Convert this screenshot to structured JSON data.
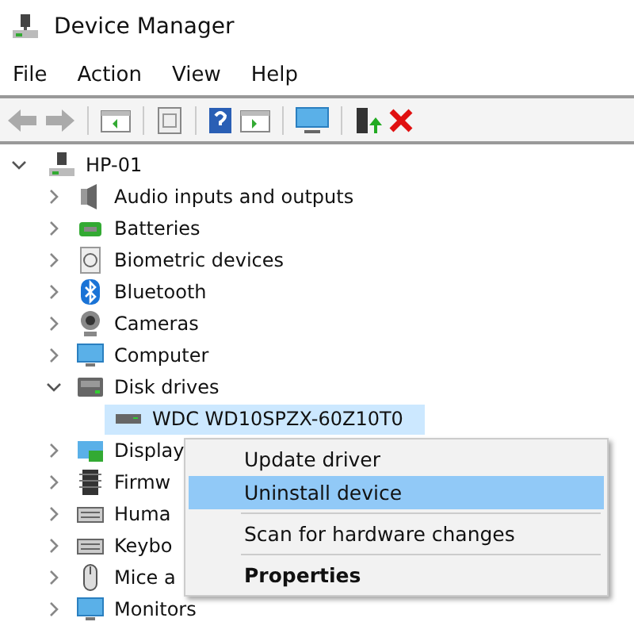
{
  "window": {
    "title": "Device Manager"
  },
  "menu_bar": [
    "File",
    "Action",
    "View",
    "Help"
  ],
  "tree": {
    "label": "HP-01",
    "expanded": true,
    "children": [
      {
        "label": "Audio inputs and outputs",
        "expanded": false
      },
      {
        "label": "Batteries",
        "expanded": false
      },
      {
        "label": "Biometric devices",
        "expanded": false
      },
      {
        "label": "Bluetooth",
        "expanded": false
      },
      {
        "label": "Cameras",
        "expanded": false
      },
      {
        "label": "Computer",
        "expanded": false
      },
      {
        "label": "Disk drives",
        "expanded": true,
        "children": [
          {
            "label": "WDC WD10SPZX-60Z10T0",
            "selected": true
          }
        ]
      },
      {
        "label": "Display",
        "expanded": false
      },
      {
        "label": "Firmw",
        "expanded": false
      },
      {
        "label": "Huma",
        "expanded": false
      },
      {
        "label": "Keybo",
        "expanded": false
      },
      {
        "label": "Mice a",
        "expanded": false
      },
      {
        "label": "Monitors",
        "expanded": false
      }
    ]
  },
  "context_menu": [
    {
      "label": "Update driver",
      "selected": false,
      "default": false,
      "separator_before": false
    },
    {
      "label": "Uninstall device",
      "selected": true,
      "default": false,
      "separator_before": false
    },
    {
      "label": "Scan for hardware changes",
      "selected": false,
      "default": false,
      "separator_before": true
    },
    {
      "label": "Properties",
      "selected": false,
      "default": true,
      "separator_before": true
    }
  ]
}
